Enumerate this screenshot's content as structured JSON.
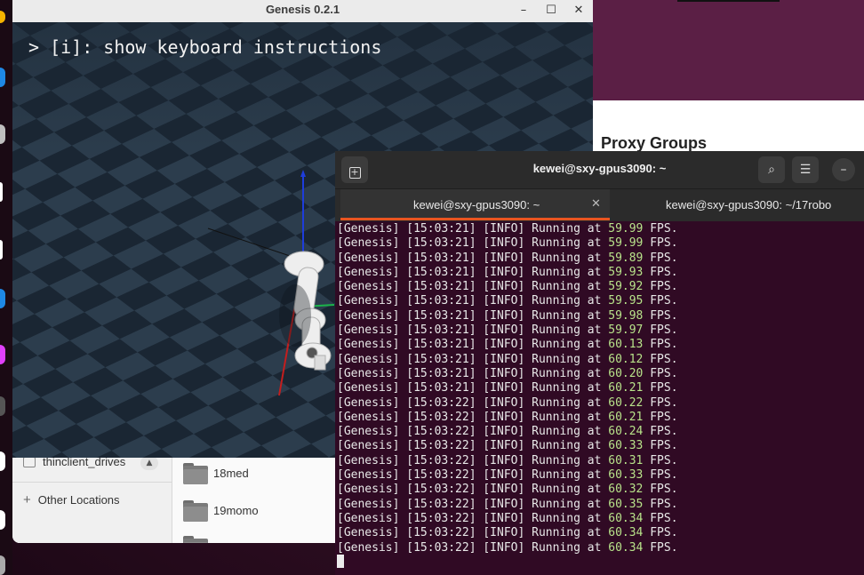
{
  "genesis_window": {
    "title": "Genesis 0.2.1",
    "overlay_text": "> [i]: show keyboard instructions",
    "controls": {
      "minimize": "–",
      "maximize": "☐",
      "close": "✕"
    }
  },
  "background_page": {
    "heading": "Proxy Groups"
  },
  "file_manager": {
    "sidebar": [
      {
        "label": "thinclient_drives",
        "icon": "drive-icon",
        "action": "eject"
      },
      {
        "label": "Other Locations",
        "icon": "plus-icon"
      }
    ],
    "folders": [
      {
        "name": "18med"
      },
      {
        "name": "19momo"
      }
    ]
  },
  "terminal": {
    "title": "kewei@sxy-gpus3090: ~",
    "tabs": [
      {
        "label": "kewei@sxy-gpus3090: ~",
        "active": true
      },
      {
        "label": "kewei@sxy-gpus3090: ~/17robo",
        "active": false
      }
    ],
    "lines": [
      {
        "prefix": "[Genesis] [15:03:21] [INFO] Running at ",
        "value": "59.99",
        "suffix": " FPS."
      },
      {
        "prefix": "[Genesis] [15:03:21] [INFO] Running at ",
        "value": "59.99",
        "suffix": " FPS."
      },
      {
        "prefix": "[Genesis] [15:03:21] [INFO] Running at ",
        "value": "59.89",
        "suffix": " FPS."
      },
      {
        "prefix": "[Genesis] [15:03:21] [INFO] Running at ",
        "value": "59.93",
        "suffix": " FPS."
      },
      {
        "prefix": "[Genesis] [15:03:21] [INFO] Running at ",
        "value": "59.92",
        "suffix": " FPS."
      },
      {
        "prefix": "[Genesis] [15:03:21] [INFO] Running at ",
        "value": "59.95",
        "suffix": " FPS."
      },
      {
        "prefix": "[Genesis] [15:03:21] [INFO] Running at ",
        "value": "59.98",
        "suffix": " FPS."
      },
      {
        "prefix": "[Genesis] [15:03:21] [INFO] Running at ",
        "value": "59.97",
        "suffix": " FPS."
      },
      {
        "prefix": "[Genesis] [15:03:21] [INFO] Running at ",
        "value": "60.13",
        "suffix": " FPS."
      },
      {
        "prefix": "[Genesis] [15:03:21] [INFO] Running at ",
        "value": "60.12",
        "suffix": " FPS."
      },
      {
        "prefix": "[Genesis] [15:03:21] [INFO] Running at ",
        "value": "60.20",
        "suffix": " FPS."
      },
      {
        "prefix": "[Genesis] [15:03:21] [INFO] Running at ",
        "value": "60.21",
        "suffix": " FPS."
      },
      {
        "prefix": "[Genesis] [15:03:22] [INFO] Running at ",
        "value": "60.22",
        "suffix": " FPS."
      },
      {
        "prefix": "[Genesis] [15:03:22] [INFO] Running at ",
        "value": "60.21",
        "suffix": " FPS."
      },
      {
        "prefix": "[Genesis] [15:03:22] [INFO] Running at ",
        "value": "60.24",
        "suffix": " FPS."
      },
      {
        "prefix": "[Genesis] [15:03:22] [INFO] Running at ",
        "value": "60.33",
        "suffix": " FPS."
      },
      {
        "prefix": "[Genesis] [15:03:22] [INFO] Running at ",
        "value": "60.31",
        "suffix": " FPS."
      },
      {
        "prefix": "[Genesis] [15:03:22] [INFO] Running at ",
        "value": "60.33",
        "suffix": " FPS."
      },
      {
        "prefix": "[Genesis] [15:03:22] [INFO] Running at ",
        "value": "60.32",
        "suffix": " FPS."
      },
      {
        "prefix": "[Genesis] [15:03:22] [INFO] Running at ",
        "value": "60.35",
        "suffix": " FPS."
      },
      {
        "prefix": "[Genesis] [15:03:22] [INFO] Running at ",
        "value": "60.34",
        "suffix": " FPS."
      },
      {
        "prefix": "[Genesis] [15:03:22] [INFO] Running at ",
        "value": "60.34",
        "suffix": " FPS."
      },
      {
        "prefix": "[Genesis] [15:03:22] [INFO] Running at ",
        "value": "60.34",
        "suffix": " FPS."
      }
    ]
  },
  "colors": {
    "terminal_bg": "#300a24",
    "fps_value": "#b8e38a",
    "accent": "#e95420"
  }
}
